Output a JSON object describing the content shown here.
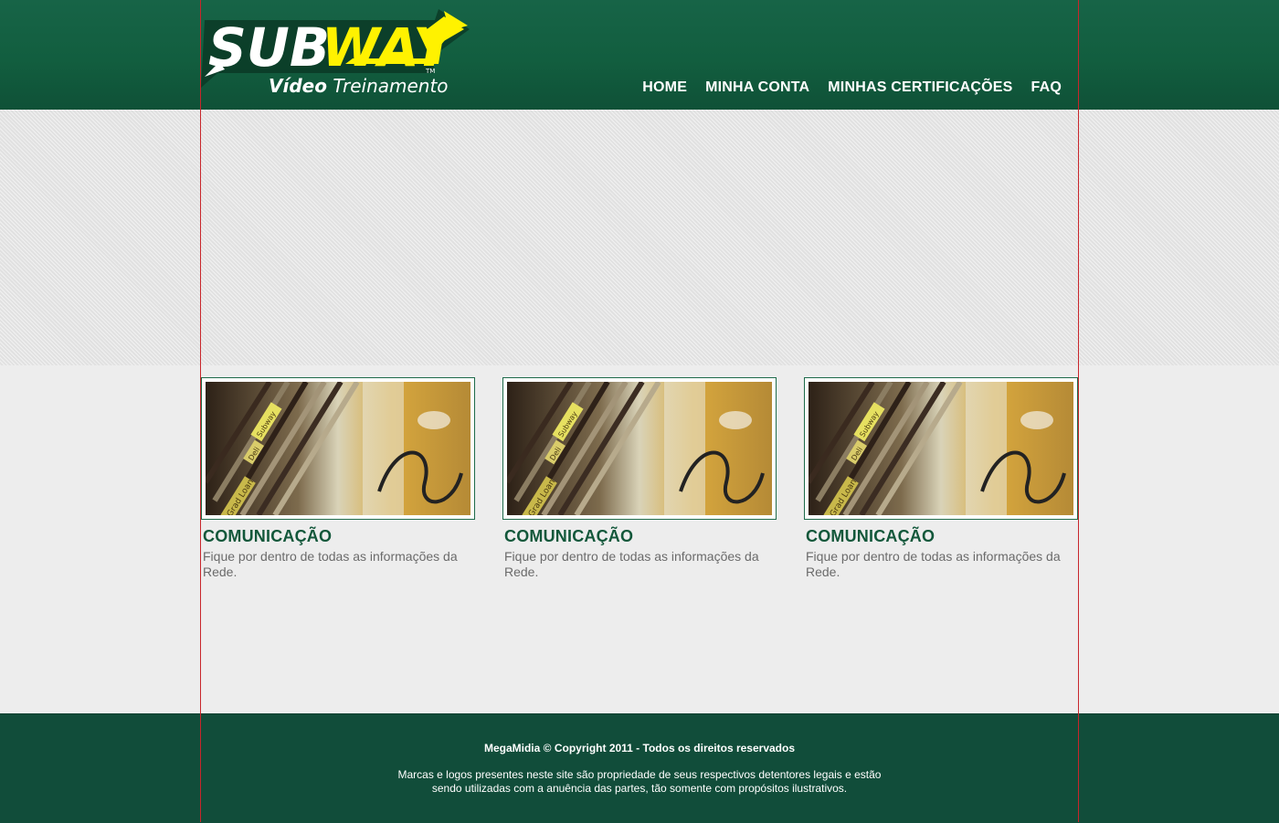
{
  "header": {
    "logo": {
      "brand": "SUBWAY",
      "trademark": "TM",
      "subtitle_bold": "Vídeo",
      "subtitle_rest": " Treinamento"
    },
    "nav": [
      {
        "label": "HOME",
        "icon": ""
      },
      {
        "label": "MINHA CONTA",
        "icon": ""
      },
      {
        "label": "MINHAS CERTIFICAÇÕES",
        "icon": ""
      },
      {
        "label": "FAQ",
        "icon": ""
      }
    ]
  },
  "cards": [
    {
      "title": "COMUNICAÇÃO",
      "text": "Fique por dentro de todas as informações da Rede.",
      "image_labels": [
        "Subway",
        "Deli",
        "Grad Loan"
      ]
    },
    {
      "title": "COMUNICAÇÃO",
      "text": "Fique por dentro de todas as informações da Rede.",
      "image_labels": [
        "Subway",
        "Deli",
        "Grad Loan"
      ]
    },
    {
      "title": "COMUNICAÇÃO",
      "text": "Fique por dentro de todas as informações da Rede.",
      "image_labels": [
        "Subway",
        "Deli",
        "Grad Loan"
      ]
    }
  ],
  "footer": {
    "copyright": "MegaMidia © Copyright 2011 - Todos os direitos reservados",
    "disclaimer": "Marcas e logos presentes neste site são propriedade de seus respectivos detentores legais e estão sendo utilizadas com a anuência das partes, tão somente com propósitos ilustrativos."
  },
  "colors": {
    "brand_green": "#12573a",
    "footer_green": "#114d3a",
    "logo_yellow": "#fff200",
    "guide_red": "#c8262b"
  }
}
